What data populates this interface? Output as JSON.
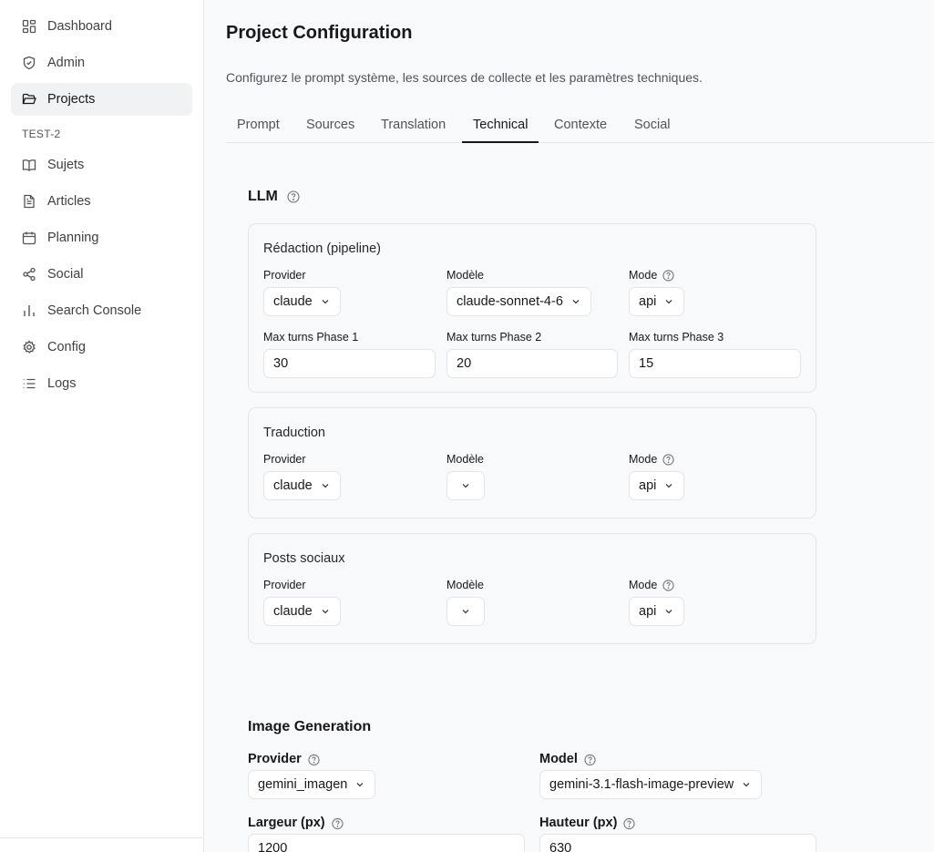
{
  "sidebar": {
    "items": [
      {
        "label": "Dashboard",
        "icon": "dashboard-icon"
      },
      {
        "label": "Admin",
        "icon": "shield-icon"
      },
      {
        "label": "Projects",
        "icon": "folder-open-icon",
        "active": true
      }
    ],
    "section_label": "TEST-2",
    "project_items": [
      {
        "label": "Sujets",
        "icon": "book-open-icon"
      },
      {
        "label": "Articles",
        "icon": "file-text-icon"
      },
      {
        "label": "Planning",
        "icon": "calendar-icon"
      },
      {
        "label": "Social",
        "icon": "share-icon"
      },
      {
        "label": "Search Console",
        "icon": "bar-chart-icon"
      },
      {
        "label": "Config",
        "icon": "gear-icon"
      },
      {
        "label": "Logs",
        "icon": "list-icon"
      }
    ]
  },
  "header": {
    "title": "Project Configuration",
    "subtitle": "Configurez le prompt système, les sources de collecte et les paramètres techniques."
  },
  "tabs": [
    {
      "label": "Prompt"
    },
    {
      "label": "Sources"
    },
    {
      "label": "Translation"
    },
    {
      "label": "Technical",
      "active": true
    },
    {
      "label": "Contexte"
    },
    {
      "label": "Social"
    }
  ],
  "llm": {
    "heading": "LLM",
    "redaction": {
      "title": "Rédaction (pipeline)",
      "provider_label": "Provider",
      "provider_value": "claude",
      "model_label": "Modèle",
      "model_value": "claude-sonnet-4-6",
      "mode_label": "Mode",
      "mode_value": "api",
      "phase1_label": "Max turns Phase 1",
      "phase1_value": "30",
      "phase2_label": "Max turns Phase 2",
      "phase2_value": "20",
      "phase3_label": "Max turns Phase 3",
      "phase3_value": "15"
    },
    "traduction": {
      "title": "Traduction",
      "provider_label": "Provider",
      "provider_value": "claude",
      "model_label": "Modèle",
      "model_value": "",
      "mode_label": "Mode",
      "mode_value": "api"
    },
    "posts": {
      "title": "Posts sociaux",
      "provider_label": "Provider",
      "provider_value": "claude",
      "model_label": "Modèle",
      "model_value": "",
      "mode_label": "Mode",
      "mode_value": "api"
    }
  },
  "image_generation": {
    "heading": "Image Generation",
    "provider_label": "Provider",
    "provider_value": "gemini_imagen",
    "model_label": "Model",
    "model_value": "gemini-3.1-flash-image-preview",
    "width_label": "Largeur (px)",
    "width_value": "1200",
    "height_label": "Hauteur (px)",
    "height_value": "630"
  },
  "colors": {
    "background": "#f8f9fb",
    "sidebar_bg": "#ffffff",
    "active_bg": "#f1f2f4",
    "border": "#e3e5e8",
    "text": "#18181b",
    "muted": "#52525b"
  }
}
